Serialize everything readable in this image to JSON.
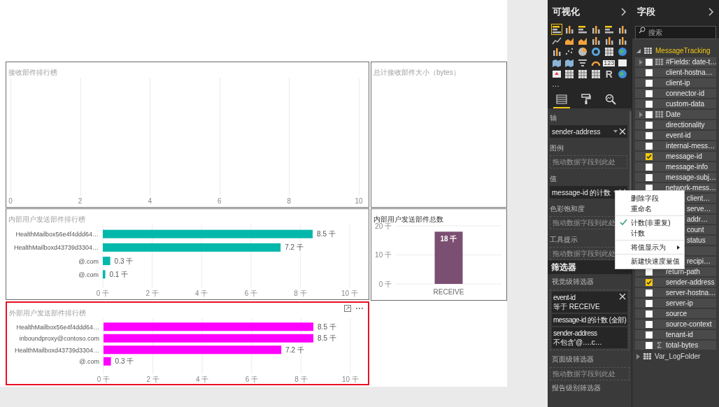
{
  "visuals": [
    {
      "kind": "empty",
      "title": "接收部件排行榜",
      "selected": false,
      "axis_labels": [
        "0",
        "2",
        "4",
        "6",
        "8",
        "10"
      ]
    },
    {
      "kind": "card",
      "title": "总计接收部件大小（bytes）",
      "selected": false
    },
    {
      "kind": "bar_h",
      "title": "内部用户发送部件排行榜",
      "selected": false,
      "chart_data": {
        "type": "bar",
        "orientation": "horizontal",
        "categories": [
          "HealthMailbox56e4f4ddd64…",
          "HealthMailboxd43739d3304…",
          "@.com",
          "@.com"
        ],
        "series": [
          {
            "color": "#01b8aa",
            "values": [
              8.5,
              7.2,
              0.3,
              0.1
            ]
          }
        ],
        "grid": true,
        "xlim": [
          0,
          10
        ],
        "xticks": [
          {
            "value": 0,
            "label": "0 千"
          },
          {
            "value": 2,
            "label": "2 千"
          },
          {
            "value": 4,
            "label": "4 千"
          },
          {
            "value": 6,
            "label": "6 千"
          },
          {
            "value": 8,
            "label": "8 千"
          },
          {
            "value": 10,
            "label": "10 千"
          }
        ],
        "value_labels": [
          "8.5 千",
          "7.2 千",
          "0.3 千",
          "0.1 千"
        ]
      }
    },
    {
      "kind": "column",
      "title": "内部用户发送部件总数",
      "selected": false,
      "chart_data": {
        "type": "bar",
        "orientation": "vertical",
        "categories": [
          "RECEIVE"
        ],
        "series": [
          {
            "color": "#7b4f72",
            "values": [
              18
            ]
          }
        ],
        "grid": true,
        "ylim": [
          0,
          20
        ],
        "yticks": [
          {
            "value": 0,
            "label": "0 千"
          },
          {
            "value": 10,
            "label": "10 千"
          },
          {
            "value": 20,
            "label": "20 千"
          }
        ],
        "value_labels": [
          "18 千"
        ]
      }
    },
    {
      "kind": "bar_h",
      "title": "外部用户发送部件排行榜",
      "selected": true,
      "chart_data": {
        "type": "bar",
        "orientation": "horizontal",
        "categories": [
          "HealthMailbox56e4f4ddd64…",
          "inboundproxy@contoso.com",
          "HealthMailboxd43739d3304…",
          "@.com"
        ],
        "series": [
          {
            "color": "#ff00ff",
            "values": [
              8.5,
              8.5,
              7.2,
              0.3
            ]
          }
        ],
        "grid": true,
        "xlim": [
          0,
          10
        ],
        "xticks": [
          {
            "value": 0,
            "label": "0 千"
          },
          {
            "value": 2,
            "label": "2 千"
          },
          {
            "value": 4,
            "label": "4 千"
          },
          {
            "value": 6,
            "label": "6 千"
          },
          {
            "value": 8,
            "label": "8 千"
          },
          {
            "value": 10,
            "label": "10 千"
          }
        ],
        "value_labels": [
          "8.5 千",
          "8.5 千",
          "7.2 千",
          "0.3 千"
        ]
      }
    }
  ],
  "visualizations": {
    "title": "可视化",
    "types": [
      {
        "kind": "bars",
        "selected": true
      },
      {
        "kind": "columns",
        "selected": false
      },
      {
        "kind": "bars",
        "selected": false
      },
      {
        "kind": "columns",
        "selected": false
      },
      {
        "kind": "bars",
        "selected": false
      },
      {
        "kind": "columns",
        "selected": false
      },
      {
        "kind": "line",
        "selected": false
      },
      {
        "kind": "area",
        "selected": false
      },
      {
        "kind": "area",
        "selected": false
      },
      {
        "kind": "columns",
        "selected": false
      },
      {
        "kind": "columns",
        "selected": false
      },
      {
        "kind": "columns",
        "selected": false
      },
      {
        "kind": "columns",
        "selected": false
      },
      {
        "kind": "scatter",
        "selected": false
      },
      {
        "kind": "pie",
        "selected": false
      },
      {
        "kind": "donut",
        "selected": false
      },
      {
        "kind": "grid",
        "selected": false
      },
      {
        "kind": "globe",
        "selected": false
      },
      {
        "kind": "map",
        "selected": false
      },
      {
        "kind": "map",
        "selected": false
      },
      {
        "kind": "funnel",
        "selected": false
      },
      {
        "kind": "gauge",
        "selected": false
      },
      {
        "kind": "card",
        "label": "123",
        "selected": false
      },
      {
        "kind": "card",
        "selected": false
      },
      {
        "kind": "kpi",
        "selected": false
      },
      {
        "kind": "grid",
        "selected": false
      },
      {
        "kind": "grid",
        "selected": false
      },
      {
        "kind": "grid",
        "selected": false
      },
      {
        "kind": "letter",
        "label": "R",
        "selected": false
      },
      {
        "kind": "globe",
        "selected": false
      }
    ],
    "more": "…",
    "tabs": [
      {
        "kind": "fields",
        "selected": true
      },
      {
        "kind": "format",
        "selected": false
      },
      {
        "kind": "analytics",
        "selected": false
      }
    ],
    "wells": [
      {
        "label": "轴",
        "field": "sender-address"
      },
      {
        "label": "图例",
        "hint": "拖动数据字段到此处"
      },
      {
        "label": "值",
        "field": "message-id 的计数"
      },
      {
        "label": "色彩饱和度",
        "hint": "拖动数据字段到此处"
      },
      {
        "label": "工具提示",
        "hint": "拖动数据字段到此处"
      }
    ]
  },
  "filters": {
    "title": "筛选器",
    "sections": [
      {
        "label": "视觉级筛选器",
        "cards": [
          {
            "field": "event-id",
            "condition": "等于 RECEIVE",
            "removable": true
          },
          {
            "field": "message-id 的计数 (全部)",
            "removable": false
          },
          {
            "field": "sender-address",
            "condition": "不包含'@….c…",
            "removable": false
          }
        ]
      },
      {
        "label": "页面级筛选器",
        "hint": "拖动数据字段到此处"
      },
      {
        "label": "报告级别筛选器"
      }
    ]
  },
  "context_menu": {
    "items": [
      {
        "kind": "item",
        "label": "删除字段",
        "checked": false
      },
      {
        "kind": "item",
        "label": "重命名",
        "checked": false
      },
      {
        "kind": "separator"
      },
      {
        "kind": "item",
        "label": "计数(非重复)",
        "checked": true
      },
      {
        "kind": "item",
        "label": "计数",
        "checked": false
      },
      {
        "kind": "separator"
      },
      {
        "kind": "submenu",
        "label": "将值显示为"
      },
      {
        "kind": "separator"
      },
      {
        "kind": "item",
        "label": "新建快速度量值",
        "checked": false
      }
    ]
  },
  "fields": {
    "title": "字段",
    "search": {
      "placeholder": "搜索"
    },
    "tables": [
      {
        "name": "MessageTracking",
        "expanded": true,
        "children": [
          {
            "kind": "table",
            "name": "#Fields: date-t…",
            "checked": false
          },
          {
            "kind": "column",
            "name": "client-hostna…",
            "checked": false
          },
          {
            "kind": "column",
            "name": "client-ip",
            "checked": false
          },
          {
            "kind": "column",
            "name": "connector-id",
            "checked": false
          },
          {
            "kind": "column",
            "name": "custom-data",
            "checked": false
          },
          {
            "kind": "table",
            "name": "Date",
            "checked": false
          },
          {
            "kind": "column",
            "name": "directionality",
            "checked": false
          },
          {
            "kind": "column",
            "name": "event-id",
            "checked": false
          },
          {
            "kind": "column",
            "name": "internal-mess…",
            "checked": false
          },
          {
            "kind": "column",
            "name": "message-id",
            "checked": true
          },
          {
            "kind": "column",
            "name": "message-info",
            "checked": false
          },
          {
            "kind": "column",
            "name": "message-subj…",
            "checked": false
          },
          {
            "kind": "column",
            "name": "network-mess…",
            "checked": false
          },
          {
            "kind": "covered",
            "name": "client…"
          },
          {
            "kind": "covered",
            "name": "serve…"
          },
          {
            "kind": "covered",
            "name": "addr…"
          },
          {
            "kind": "covered",
            "name": "count"
          },
          {
            "kind": "covered",
            "name": "status"
          },
          {
            "kind": "covered"
          },
          {
            "kind": "covered",
            "name": "recipi…"
          },
          {
            "kind": "column",
            "name": "return-path",
            "checked": false
          },
          {
            "kind": "column",
            "name": "sender-address",
            "checked": true
          },
          {
            "kind": "column",
            "name": "server-hostna…",
            "checked": false
          },
          {
            "kind": "column",
            "name": "server-ip",
            "checked": false
          },
          {
            "kind": "column",
            "name": "source",
            "checked": false
          },
          {
            "kind": "column",
            "name": "source-context",
            "checked": false
          },
          {
            "kind": "column",
            "name": "tenant-id",
            "checked": false
          },
          {
            "kind": "measure",
            "name": "total-bytes",
            "checked": false
          }
        ]
      },
      {
        "name": "Var_LogFolder",
        "expanded": false
      }
    ]
  }
}
